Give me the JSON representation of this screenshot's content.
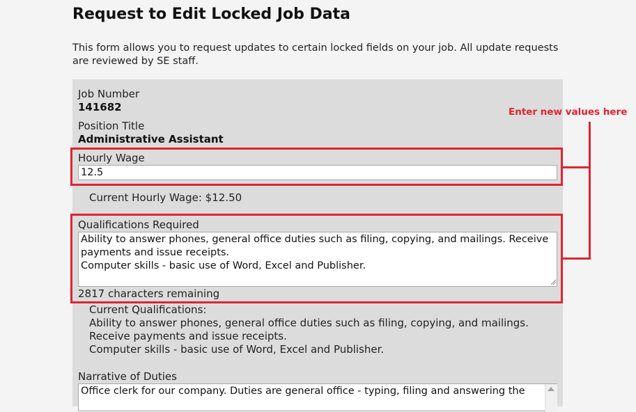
{
  "page": {
    "title": "Request to Edit Locked Job Data",
    "intro": "This form allows you to request updates to certain locked fields on your job. All update requests are reviewed by SE staff."
  },
  "job_number": {
    "label": "Job Number",
    "value": "141682"
  },
  "position_title": {
    "label": "Position Title",
    "value": "Administrative Assistant"
  },
  "hourly_wage": {
    "label": "Hourly Wage",
    "input_value": "12.5",
    "current_text": "Current Hourly Wage: $12.50"
  },
  "qualifications": {
    "label": "Qualifications Required",
    "input_value": "Ability to answer phones, general office duties such as filing, copying, and mailings. Receive payments and issue receipts.\nComputer skills - basic use of Word, Excel and Publisher.",
    "remaining": "2817 characters remaining",
    "current_label": "Current Qualifications:",
    "current_line1": "Ability to answer phones, general office duties such as filing, copying, and mailings. Receive payments and issue receipts.",
    "current_line2": "Computer skills - basic use of Word, Excel and Publisher."
  },
  "narrative": {
    "label": "Narrative of Duties",
    "input_value": "Office clerk for our company. Duties are general office - typing, filing and answering the"
  },
  "annotation": {
    "text": "Enter new values here",
    "color": "#e02430"
  }
}
